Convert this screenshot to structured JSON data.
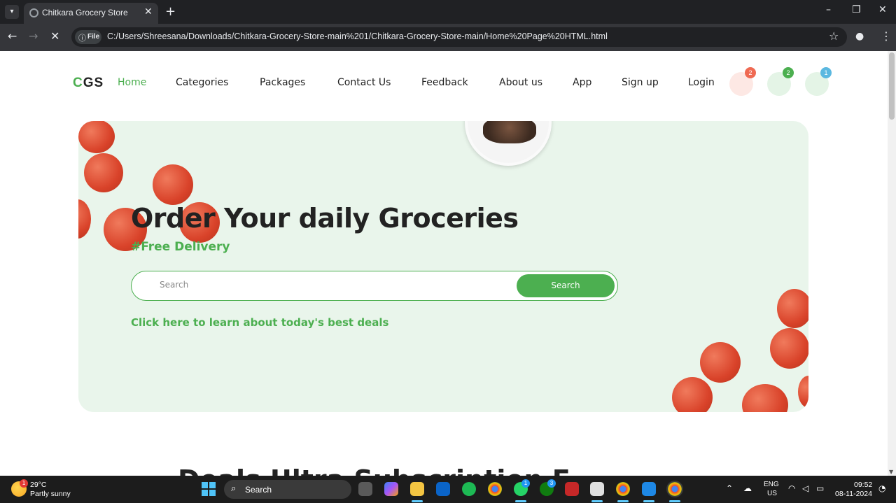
{
  "browser": {
    "tab_title": "Chitkara Grocery Store",
    "tab_close": "✕",
    "new_tab": "+",
    "site_chip": "File",
    "url": "C:/Users/Shreesana/Downloads/Chitkara-Grocery-Store-main%201/Chitkara-Grocery-Store-main/Home%20Page%20HTML.html"
  },
  "site": {
    "logo_first": "C",
    "logo_rest": "GS",
    "nav": {
      "home": "Home",
      "categories": "Categories",
      "packages": "Packages",
      "contact": "Contact Us",
      "feedback": "Feedback",
      "about": "About us",
      "app": "App",
      "signup": "Sign up",
      "login": "Login"
    },
    "badges": {
      "first": "2",
      "second": "2",
      "third": "1"
    },
    "colors": {
      "accent": "#4caf50",
      "hero_bg": "#e9f5eb",
      "badge_red": "#ef6a53",
      "badge_green": "#4caf50",
      "badge_blue": "#5bb8e0"
    }
  },
  "hero": {
    "title": "Order Your daily Groceries",
    "subtitle": "#Free Delivery",
    "search_placeholder": "Search",
    "search_button": "Search",
    "deals_link": "Click here to learn about today's best deals"
  },
  "next_section": {
    "heading_partial": "Deals  Ultra  Subscription  E"
  },
  "taskbar": {
    "weather_temp": "29°C",
    "weather_desc": "Partly sunny",
    "weather_badge": "1",
    "search_label": "Search",
    "outlook_badge": "1",
    "whatsapp_badge": "1",
    "xbox_badge": "3",
    "lang_line1": "ENG",
    "lang_line2": "US",
    "time": "09:52",
    "date": "08-11-2024"
  }
}
